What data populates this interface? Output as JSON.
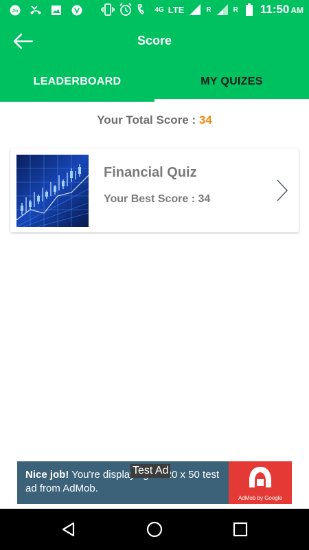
{
  "status_bar": {
    "time": "11:50",
    "ampm": "AM",
    "network": "4G",
    "lte": "LTE",
    "roaming1": "R",
    "roaming2": "R",
    "carrier_icon": "Jio",
    "icons_left": [
      "jio-icon",
      "missed-call-icon",
      "image-icon",
      "vpn-shield-icon"
    ],
    "icons_right": [
      "vibrate-icon",
      "alarm-icon",
      "signal-icon",
      "battery-icon"
    ]
  },
  "toolbar": {
    "title": "Score",
    "back_icon": "arrow-left-icon"
  },
  "tabs": [
    {
      "label": "LEADERBOARD",
      "active": true
    },
    {
      "label": "MY QUIZES",
      "active": false
    }
  ],
  "total_score": {
    "label": "Your Total Score : ",
    "value": "34"
  },
  "quizzes": [
    {
      "title": "Financial Quiz",
      "best_score_label": "Your Best Score : 34",
      "thumbnail": "financial-chart-image"
    }
  ],
  "ad": {
    "headline": "Nice job!",
    "body": " You're displaying a 320 x 50 test ad from AdMob.",
    "badge": "Test Ad",
    "logo_caption": "AdMob by Google"
  },
  "colors": {
    "primary": "#00c160",
    "accent": "#f28a14",
    "ad_bg": "#3c6279",
    "ad_logo": "#e53935"
  }
}
